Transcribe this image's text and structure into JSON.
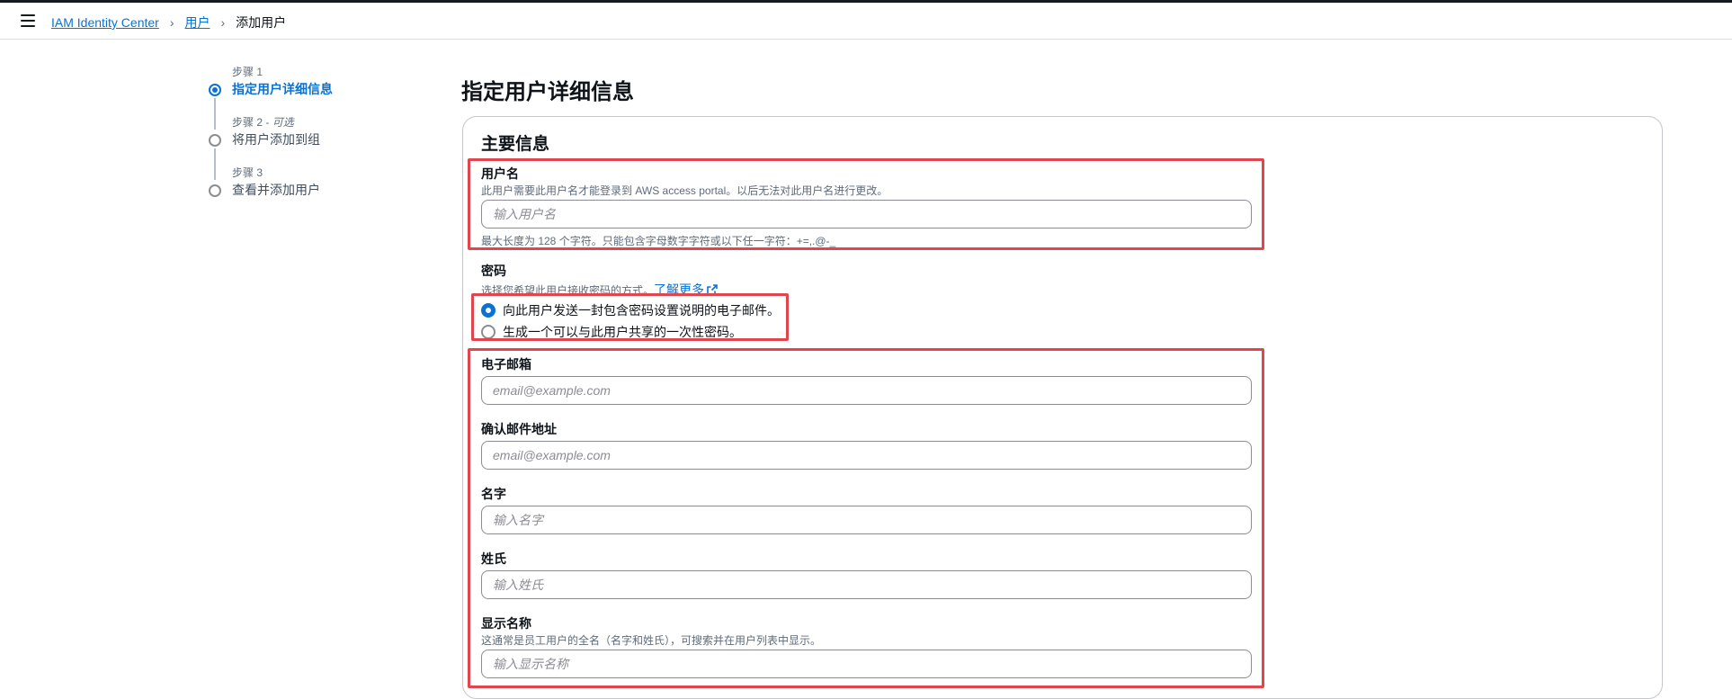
{
  "breadcrumb": {
    "items": [
      "IAM Identity Center",
      "用户"
    ],
    "current": "添加用户"
  },
  "steps": [
    {
      "small": "步骤 1",
      "optional": "",
      "title": "指定用户详细信息",
      "active": true
    },
    {
      "small": "步骤 2 - ",
      "optional": "可选",
      "title": "将用户添加到组",
      "active": false
    },
    {
      "small": "步骤 3",
      "optional": "",
      "title": "查看并添加用户",
      "active": false
    }
  ],
  "page_title": "指定用户详细信息",
  "section_title": "主要信息",
  "username": {
    "label": "用户名",
    "description": "此用户需要此用户名才能登录到 AWS access portal。以后无法对此用户名进行更改。",
    "placeholder": "输入用户名",
    "constraint": "最大长度为 128 个字符。只能包含字母数字字符或以下任一字符：+=,.@-_"
  },
  "password": {
    "label": "密码",
    "description": "选择您希望此用户接收密码的方式。",
    "learn_more": "了解更多",
    "options": [
      "向此用户发送一封包含密码设置说明的电子邮件。",
      "生成一个可以与此用户共享的一次性密码。"
    ],
    "selected_index": 0
  },
  "email": {
    "label": "电子邮箱",
    "placeholder": "email@example.com"
  },
  "confirm_email": {
    "label": "确认邮件地址",
    "placeholder": "email@example.com"
  },
  "first_name": {
    "label": "名字",
    "placeholder": "输入名字"
  },
  "last_name": {
    "label": "姓氏",
    "placeholder": "输入姓氏"
  },
  "display_name": {
    "label": "显示名称",
    "description": "这通常是员工用户的全名（名字和姓氏），可搜索并在用户列表中显示。",
    "placeholder": "输入显示名称"
  },
  "colors": {
    "accent": "#0972d3",
    "highlight": "#e0464e"
  }
}
